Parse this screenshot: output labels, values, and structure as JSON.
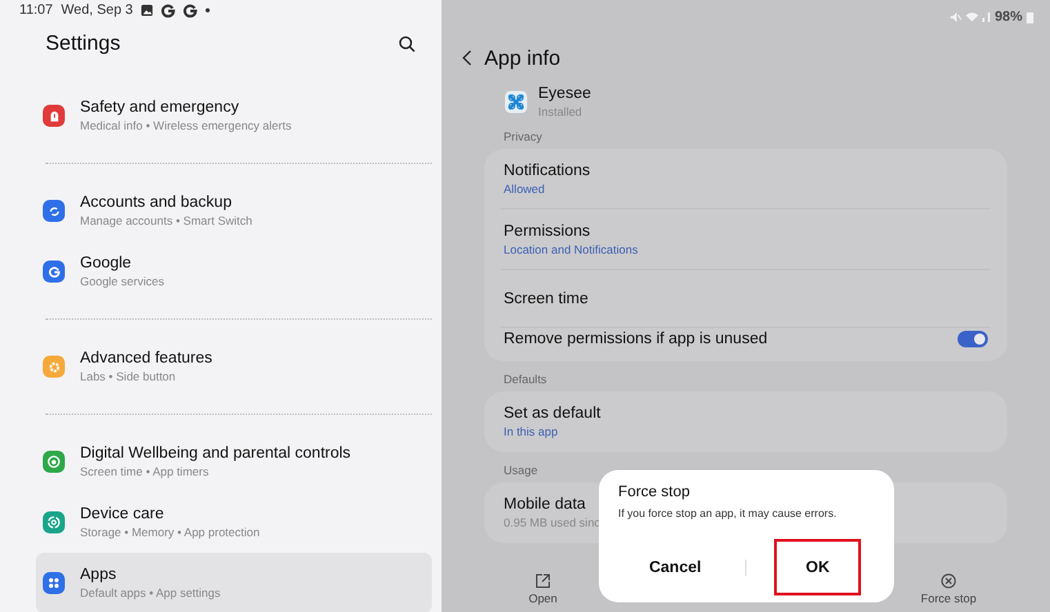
{
  "status_bar": {
    "time": "11:07",
    "date": "Wed, Sep 3",
    "battery": "98%"
  },
  "settings": {
    "title": "Settings",
    "groups": [
      [
        {
          "title": "Safety and emergency",
          "subtitle": "Medical info • Wireless emergency alerts",
          "color": "#e03a3a",
          "selected": false
        }
      ],
      [
        {
          "title": "Accounts and backup",
          "subtitle": "Manage accounts • Smart Switch",
          "color": "#2f6fe8",
          "selected": false
        },
        {
          "title": "Google",
          "subtitle": "Google services",
          "color": "#2f6fe8",
          "selected": false
        }
      ],
      [
        {
          "title": "Advanced features",
          "subtitle": "Labs • Side button",
          "color": "#f5a93b",
          "selected": false
        }
      ],
      [
        {
          "title": "Digital Wellbeing and parental controls",
          "subtitle": "Screen time • App timers",
          "color": "#2ea84a",
          "selected": false
        },
        {
          "title": "Device care",
          "subtitle": "Storage • Memory • App protection",
          "color": "#1aa58a",
          "selected": false
        },
        {
          "title": "Apps",
          "subtitle": "Default apps • App settings",
          "color": "#2f6fe8",
          "selected": true
        }
      ]
    ]
  },
  "app_info": {
    "title": "App info",
    "app_name": "Eyesee",
    "app_status": "Installed",
    "sections": [
      {
        "label": "Privacy",
        "rows": [
          {
            "kind": "link",
            "title": "Notifications",
            "value": "Allowed"
          },
          {
            "kind": "link",
            "title": "Permissions",
            "value": "Location and Notifications"
          },
          {
            "kind": "plain",
            "title": "Screen time"
          },
          {
            "kind": "toggle",
            "title": "Remove permissions if app is unused",
            "on": true
          }
        ]
      },
      {
        "label": "Defaults",
        "rows": [
          {
            "kind": "link",
            "title": "Set as default",
            "value": "In this app"
          }
        ]
      },
      {
        "label": "Usage",
        "rows": [
          {
            "kind": "detail",
            "title": "Mobile data",
            "value": "0.95 MB used sinc"
          }
        ]
      }
    ],
    "actions": [
      {
        "label": "Open"
      },
      {
        "label": "Force stop"
      }
    ]
  },
  "dialog": {
    "title": "Force stop",
    "message": "If you force stop an app, it may cause errors.",
    "buttons": [
      {
        "label": "Cancel",
        "highlighted": false
      },
      {
        "label": "OK",
        "highlighted": true
      }
    ]
  }
}
